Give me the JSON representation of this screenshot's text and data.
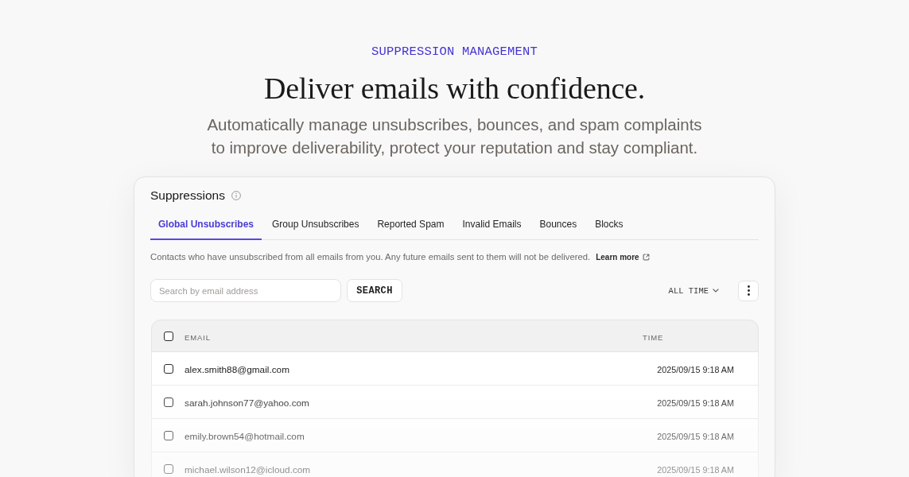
{
  "eyebrow": "SUPPRESSION MANAGEMENT",
  "headline": "Deliver emails with confidence.",
  "subtitle": "Automatically manage unsubscribes, bounces, and spam complaints to improve deliverability, protect your reputation and stay compliant.",
  "panel": {
    "title": "Suppressions",
    "tabs": [
      {
        "label": "Global Unsubscribes",
        "selected": true
      },
      {
        "label": "Group Unsubscribes",
        "selected": false
      },
      {
        "label": "Reported Spam",
        "selected": false
      },
      {
        "label": "Invalid Emails",
        "selected": false
      },
      {
        "label": "Bounces",
        "selected": false
      },
      {
        "label": "Blocks",
        "selected": false
      }
    ],
    "description": "Contacts who have unsubscribed from all emails from you. Any future emails sent to them will not be delivered.",
    "learn_more": "Learn more",
    "search": {
      "placeholder": "Search by email address"
    },
    "search_button": "SEARCH",
    "time_filter": "ALL TIME",
    "table": {
      "header_checked": false,
      "columns": [
        "EMAIL",
        "TIME"
      ],
      "rows": [
        {
          "email": "alex.smith88@gmail.com",
          "time": "2025/09/15 9:18 AM",
          "checked": false
        },
        {
          "email": "sarah.johnson77@yahoo.com",
          "time": "2025/09/15 9:18 AM",
          "checked": false
        },
        {
          "email": "emily.brown54@hotmail.com",
          "time": "2025/09/15 9:18 AM",
          "checked": false
        },
        {
          "email": "michael.wilson12@icloud.com",
          "time": "2025/09/15 9:18 AM",
          "checked": false
        }
      ]
    }
  }
}
